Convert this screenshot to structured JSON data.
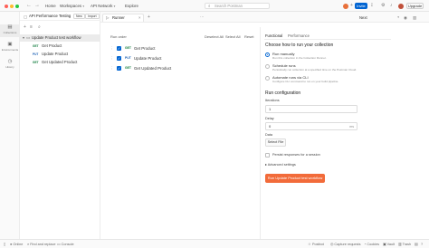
{
  "topbar": {
    "nav": {
      "back_icon": "arrow-left-icon",
      "forward_icon": "arrow-right-icon"
    },
    "menu": {
      "home": "Home",
      "workspaces": "Workspaces",
      "api_network": "API Network",
      "explore": "Explore"
    },
    "search": {
      "placeholder": "Search Postman"
    },
    "invite_label": "Invite",
    "upgrade_label": "Upgrade"
  },
  "iconrail": {
    "items": [
      {
        "icon": "collections-icon",
        "label": "Collections"
      },
      {
        "icon": "environments-icon",
        "label": "Environments"
      },
      {
        "icon": "history-icon",
        "label": "History"
      }
    ]
  },
  "sidebar": {
    "workspace_name": "API Performance Testing",
    "new_label": "New",
    "import_label": "Import",
    "tree": [
      {
        "type": "folder",
        "label": "Update Product test workflow"
      },
      {
        "type": "request",
        "method": "GET",
        "label": "Get Product"
      },
      {
        "type": "request",
        "method": "PUT",
        "label": "Update Product"
      },
      {
        "type": "request",
        "method": "GET",
        "label": "Get Updated Product"
      }
    ]
  },
  "tabs": {
    "active": {
      "label": "Runner"
    },
    "environment": "Next"
  },
  "runner": {
    "run_order_label": "Run order",
    "deselect_all": "Deselect All",
    "select_all": "Select All",
    "reset": "Reset",
    "requests": [
      {
        "method": "GET",
        "name": "Get Product",
        "checked": true
      },
      {
        "method": "PUT",
        "name": "Update Product",
        "checked": true
      },
      {
        "method": "GET",
        "name": "Get Updated Product",
        "checked": true
      }
    ]
  },
  "config": {
    "tab_functional": "Functional",
    "tab_performance": "Performance",
    "choose_heading": "Choose how to run your collection",
    "options": [
      {
        "title": "Run manually",
        "desc": "Run this collection in the Collection Runner.",
        "selected": true
      },
      {
        "title": "Schedule runs",
        "desc": "Periodically run collection at a specified time on the Postman Cloud.",
        "selected": false
      },
      {
        "title": "Automate runs via CLI",
        "desc": "Configure CLI command to run on your build pipeline.",
        "selected": false
      }
    ],
    "run_config_heading": "Run configuration",
    "iterations_label": "Iterations",
    "iterations_value": "1",
    "delay_label": "Delay",
    "delay_value": "0",
    "delay_unit": "ms",
    "data_label": "Data",
    "select_file": "Select File",
    "persist_label": "Persist responses for a session",
    "advanced_label": "Advanced settings",
    "run_button": "Run Update Product test workflow"
  },
  "statusbar": {
    "online": "Online",
    "find_replace": "Find and replace",
    "console": "Console",
    "postbot": "Postbot",
    "capture": "Capture requests",
    "cookies": "Cookies",
    "vault": "Vault",
    "trash": "Trash"
  }
}
